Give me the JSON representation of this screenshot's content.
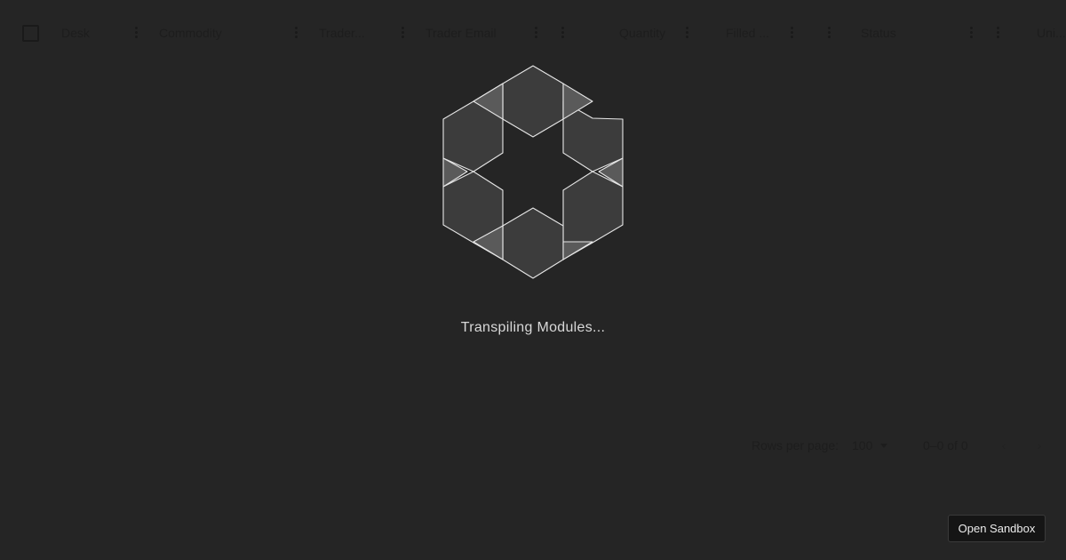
{
  "grid": {
    "columns": [
      {
        "label": "Desk"
      },
      {
        "label": "Commodity"
      },
      {
        "label": "Trader..."
      },
      {
        "label": "Trader Email"
      },
      {
        "label": "Quantity"
      },
      {
        "label": "Filled ..."
      },
      {
        "label": "Status"
      },
      {
        "label": "Uni..."
      }
    ],
    "footer": {
      "rows_per_page_label": "Rows per page:",
      "rows_per_page_value": "100",
      "range_text": "0–0 of 0",
      "prev_glyph": "‹",
      "next_glyph": "›"
    }
  },
  "loader": {
    "message": "Transpiling Modules...",
    "icon": "hexagon-loader-icon"
  },
  "sandbox": {
    "button_label": "Open Sandbox"
  },
  "colors": {
    "background": "#252525",
    "loader_fill": "#3c3c3c",
    "loader_stroke": "#e6e6e6",
    "loader_text": "#d8d8d8"
  }
}
